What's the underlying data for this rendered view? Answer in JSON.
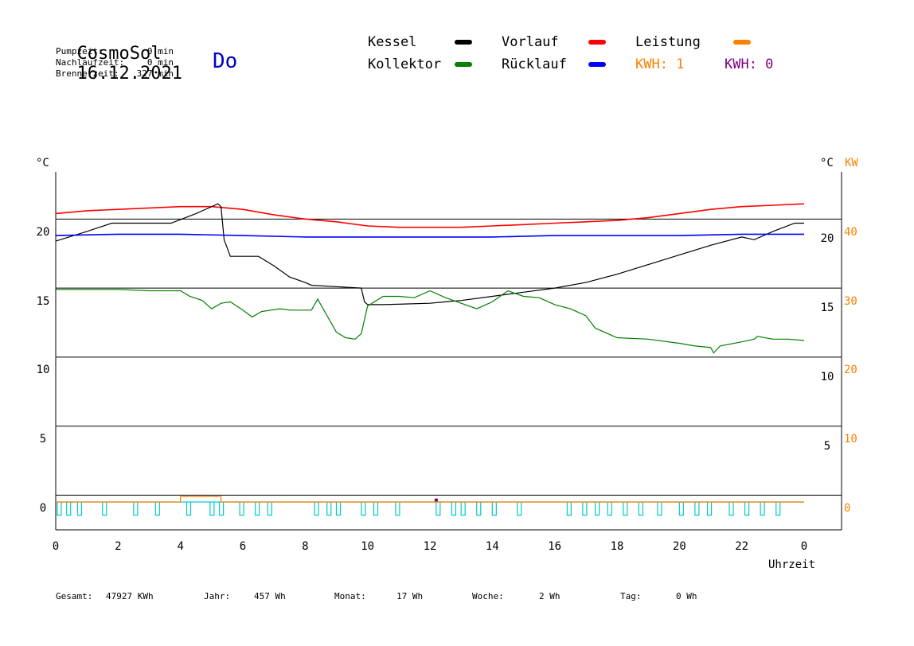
{
  "header": {
    "app_name": "CosmoSol",
    "date": "16.12.2021",
    "day": "Do",
    "stats": [
      {
        "label": "Pumpzeit:",
        "value": "0 min"
      },
      {
        "label": "Nachlaufzeit:",
        "value": "0 min"
      },
      {
        "label": "Brennerzeit:",
        "value": "327 min"
      }
    ]
  },
  "legend": {
    "items": [
      {
        "label": "Kessel",
        "color": "#000000"
      },
      {
        "label": "Vorlauf",
        "color": "#ff0000"
      },
      {
        "label": "Leistung",
        "color": "#ff8000"
      },
      {
        "label": "Kollektor",
        "color": "#008000"
      },
      {
        "label": "Rücklauf",
        "color": "#0000ff"
      }
    ],
    "kwh_orange": "KWH: 1",
    "kwh_purple": "KWH: 0",
    "kwh_orange_color": "#ff8000",
    "kwh_purple_color": "#800080"
  },
  "axes": {
    "left_unit": "°C",
    "right_unit": "°C",
    "right_kw_unit": "KW",
    "xlabel": "Uhrzeit"
  },
  "footer": [
    {
      "label": "Gesamt:",
      "value": "47927 KWh"
    },
    {
      "label": "Jahr:",
      "value": "457 Wh"
    },
    {
      "label": "Monat:",
      "value": "17 Wh"
    },
    {
      "label": "Woche:",
      "value": "2 Wh"
    },
    {
      "label": "Tag:",
      "value": "0 Wh"
    }
  ],
  "chart_data": {
    "type": "line",
    "xlabel": "Uhrzeit",
    "x_ticks": [
      "0",
      "2",
      "4",
      "6",
      "8",
      "10",
      "12",
      "14",
      "16",
      "18",
      "20",
      "22",
      "0"
    ],
    "xlim": [
      0,
      24
    ],
    "ylim_left": [
      -2,
      24.5
    ],
    "y_ticks_left": [
      "20",
      "15",
      "10",
      "5",
      "0"
    ],
    "y_ticks_right": [
      "20",
      "15",
      "10",
      "5"
    ],
    "y_ticks_kw": [
      "40",
      "30",
      "20",
      "10",
      "0"
    ],
    "series": [
      {
        "name": "Vorlauf",
        "color": "#ff0000",
        "x": [
          0,
          1,
          2,
          3,
          4,
          5,
          6,
          7,
          8,
          9,
          10,
          11,
          12,
          13,
          14,
          15,
          16,
          17,
          18,
          19,
          20,
          21,
          22,
          23,
          24
        ],
        "y": [
          20.9,
          21.1,
          21.2,
          21.3,
          21.4,
          21.4,
          21.2,
          20.8,
          20.5,
          20.3,
          20.0,
          19.9,
          19.9,
          19.9,
          20.0,
          20.1,
          20.2,
          20.3,
          20.4,
          20.6,
          20.9,
          21.2,
          21.4,
          21.5,
          21.6
        ]
      },
      {
        "name": "Kessel",
        "color": "#000000",
        "x": [
          0,
          1,
          1.8,
          3.7,
          4.5,
          5.2,
          5.3,
          5.4,
          5.6,
          6.5,
          7.0,
          7.5,
          8.0,
          8.2,
          9.0,
          9.8,
          9.9,
          10.0,
          10.5,
          12.0,
          12.5,
          13.0,
          14.0,
          15.0,
          16.0,
          17.0,
          18.0,
          19.0,
          20.0,
          21.0,
          22.0,
          22.4,
          23.0,
          23.7,
          24.0
        ],
        "y": [
          18.9,
          19.6,
          20.2,
          20.2,
          20.9,
          21.6,
          21.4,
          19.0,
          17.8,
          17.8,
          17.1,
          16.3,
          15.9,
          15.7,
          15.6,
          15.5,
          14.5,
          14.3,
          14.3,
          14.4,
          14.5,
          14.6,
          14.9,
          15.2,
          15.5,
          15.9,
          16.5,
          17.2,
          17.9,
          18.6,
          19.2,
          19.0,
          19.6,
          20.2,
          20.2
        ]
      },
      {
        "name": "Rücklauf",
        "color": "#0000ff",
        "x": [
          0,
          2,
          4,
          6,
          8,
          10,
          12,
          14,
          16,
          18,
          20,
          22,
          24
        ],
        "y": [
          19.3,
          19.4,
          19.4,
          19.3,
          19.2,
          19.2,
          19.2,
          19.2,
          19.3,
          19.3,
          19.3,
          19.4,
          19.4
        ]
      },
      {
        "name": "Kollektor",
        "color": "#008000",
        "x": [
          0,
          1,
          2,
          3,
          3.5,
          4,
          4.3,
          4.7,
          5.0,
          5.3,
          5.6,
          6.0,
          6.3,
          6.6,
          6.9,
          7.2,
          7.5,
          8.0,
          8.2,
          8.4,
          8.7,
          9.0,
          9.3,
          9.6,
          9.8,
          10.0,
          10.5,
          11.0,
          11.5,
          12.0,
          12.5,
          13.0,
          13.5,
          14.0,
          14.5,
          15.0,
          15.5,
          16.0,
          16.5,
          17.0,
          17.3,
          17.7,
          18.0,
          19.0,
          20.0,
          20.5,
          21.0,
          21.1,
          21.3,
          22.0,
          22.4,
          22.5,
          23.0,
          23.5,
          24.0
        ],
        "y": [
          15.4,
          15.4,
          15.4,
          15.3,
          15.3,
          15.3,
          14.9,
          14.6,
          14.0,
          14.4,
          14.5,
          13.9,
          13.4,
          13.8,
          13.9,
          14.0,
          13.9,
          13.9,
          13.9,
          14.7,
          13.5,
          12.3,
          11.9,
          11.8,
          12.2,
          14.2,
          14.9,
          14.9,
          14.8,
          15.3,
          14.8,
          14.4,
          14.0,
          14.5,
          15.3,
          14.9,
          14.8,
          14.3,
          14.0,
          13.5,
          12.6,
          12.2,
          11.9,
          11.8,
          11.5,
          11.3,
          11.2,
          10.8,
          11.3,
          11.6,
          11.8,
          12.0,
          11.8,
          11.8,
          11.7
        ]
      },
      {
        "name": "Leistung",
        "color": "#ff8000",
        "x": [
          0,
          4,
          4,
          5.3,
          5.3,
          24
        ],
        "y": [
          0,
          0,
          0.4,
          0.4,
          0,
          0
        ]
      }
    ],
    "grid_lines_at": [
      20.5,
      15.5,
      10.5,
      5.5,
      0.5
    ]
  }
}
